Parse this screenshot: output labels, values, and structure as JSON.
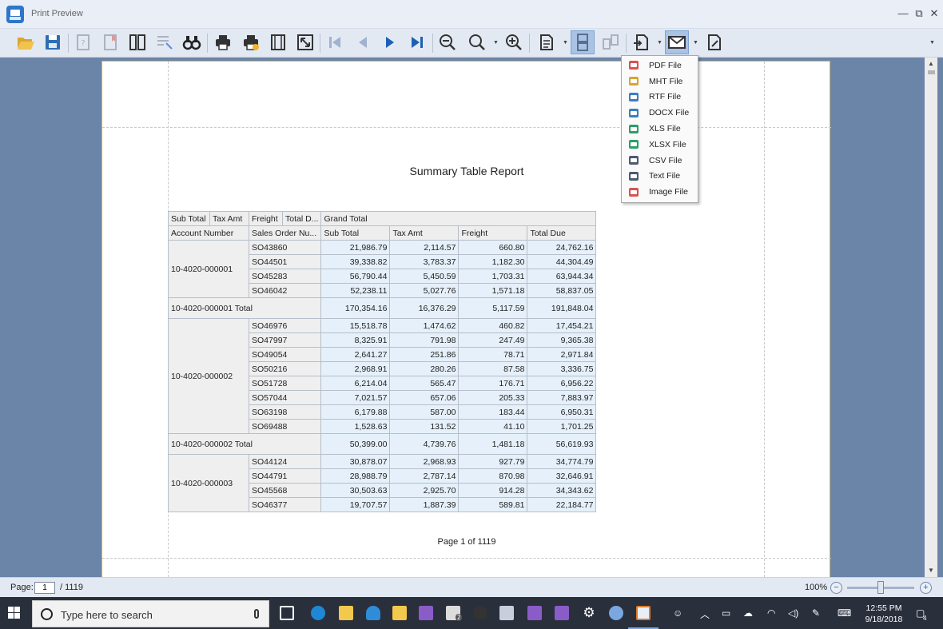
{
  "window": {
    "title": "Print Preview",
    "controls": {
      "minimize": "—",
      "restore": "⧉",
      "close": "✕"
    }
  },
  "toolbar": {
    "buttons": [
      "open-icon",
      "save-icon",
      "parameters-icon",
      "bookmarks-icon",
      "thumbnails-icon",
      "editing-fields-icon",
      "search-icon",
      "print-icon",
      "quick-print-icon",
      "page-setup-icon",
      "scale-icon",
      "first-page-icon",
      "previous-page-icon",
      "next-page-icon",
      "last-page-icon",
      "zoom-out-icon",
      "zoom-icon",
      "zoom-in-icon",
      "view-mode-icon",
      "multiple-pages-icon",
      "watermark-icon",
      "export-icon",
      "send-email-icon",
      "edit-document-icon"
    ],
    "pressed": [
      "continuous-view-icon",
      "send-email-icon"
    ]
  },
  "export_menu": {
    "items": [
      {
        "label": "PDF File",
        "color": "#d9534f"
      },
      {
        "label": "MHT File",
        "color": "#d9a534"
      },
      {
        "label": "RTF File",
        "color": "#3a7fc0"
      },
      {
        "label": "DOCX File",
        "color": "#3a7fc0"
      },
      {
        "label": "XLS File",
        "color": "#2e9e6a"
      },
      {
        "label": "XLSX File",
        "color": "#2e9e6a"
      },
      {
        "label": "CSV File",
        "color": "#4b5a70"
      },
      {
        "label": "Text File",
        "color": "#4b5a70"
      },
      {
        "label": "Image File",
        "color": "#d9534f"
      }
    ]
  },
  "report": {
    "title": "Summary Table Report",
    "footer": "Page 1 of 1119",
    "field_header": [
      "Sub Total",
      "Tax Amt",
      "Freight",
      "Total D..."
    ],
    "grand_total": "Grand Total",
    "row_headers": [
      "Account Number",
      "Sales Order Nu..."
    ],
    "col_headers": [
      "Sub Total",
      "Tax Amt",
      "Freight",
      "Total Due"
    ],
    "groups": [
      {
        "account": "10-4020-000001",
        "rows": [
          {
            "order": "SO43860",
            "vals": [
              "21,986.79",
              "2,114.57",
              "660.80",
              "24,762.16"
            ]
          },
          {
            "order": "SO44501",
            "vals": [
              "39,338.82",
              "3,783.37",
              "1,182.30",
              "44,304.49"
            ]
          },
          {
            "order": "SO45283",
            "vals": [
              "56,790.44",
              "5,450.59",
              "1,703.31",
              "63,944.34"
            ]
          },
          {
            "order": "SO46042",
            "vals": [
              "52,238.11",
              "5,027.76",
              "1,571.18",
              "58,837.05"
            ]
          }
        ],
        "total_label": "10-4020-000001 Total",
        "total": [
          "170,354.16",
          "16,376.29",
          "5,117.59",
          "191,848.04"
        ]
      },
      {
        "account": "10-4020-000002",
        "rows": [
          {
            "order": "SO46976",
            "vals": [
              "15,518.78",
              "1,474.62",
              "460.82",
              "17,454.21"
            ]
          },
          {
            "order": "SO47997",
            "vals": [
              "8,325.91",
              "791.98",
              "247.49",
              "9,365.38"
            ]
          },
          {
            "order": "SO49054",
            "vals": [
              "2,641.27",
              "251.86",
              "78.71",
              "2,971.84"
            ]
          },
          {
            "order": "SO50216",
            "vals": [
              "2,968.91",
              "280.26",
              "87.58",
              "3,336.75"
            ]
          },
          {
            "order": "SO51728",
            "vals": [
              "6,214.04",
              "565.47",
              "176.71",
              "6,956.22"
            ]
          },
          {
            "order": "SO57044",
            "vals": [
              "7,021.57",
              "657.06",
              "205.33",
              "7,883.97"
            ]
          },
          {
            "order": "SO63198",
            "vals": [
              "6,179.88",
              "587.00",
              "183.44",
              "6,950.31"
            ]
          },
          {
            "order": "SO69488",
            "vals": [
              "1,528.63",
              "131.52",
              "41.10",
              "1,701.25"
            ]
          }
        ],
        "total_label": "10-4020-000002 Total",
        "total": [
          "50,399.00",
          "4,739.76",
          "1,481.18",
          "56,619.93"
        ]
      },
      {
        "account": "10-4020-000003",
        "rows": [
          {
            "order": "SO44124",
            "vals": [
              "30,878.07",
              "2,968.93",
              "927.79",
              "34,774.79"
            ]
          },
          {
            "order": "SO44791",
            "vals": [
              "28,988.79",
              "2,787.14",
              "870.98",
              "32,646.91"
            ]
          },
          {
            "order": "SO45568",
            "vals": [
              "30,503.63",
              "2,925.70",
              "914.28",
              "34,343.62"
            ]
          },
          {
            "order": "SO46377",
            "vals": [
              "19,707.57",
              "1,887.39",
              "589.81",
              "22,184.77"
            ]
          }
        ]
      }
    ]
  },
  "status": {
    "page_label": "Page:",
    "page_value": "1",
    "page_total": "/ 1119",
    "zoom": "100%",
    "zoom_minus": "−",
    "zoom_plus": "+",
    "zoom_fraction": 0.5
  },
  "taskbar": {
    "search_placeholder": "Type here to search",
    "time": "12:55 PM",
    "date": "9/18/2018",
    "notification_count": "4",
    "mail_badge": "2"
  }
}
